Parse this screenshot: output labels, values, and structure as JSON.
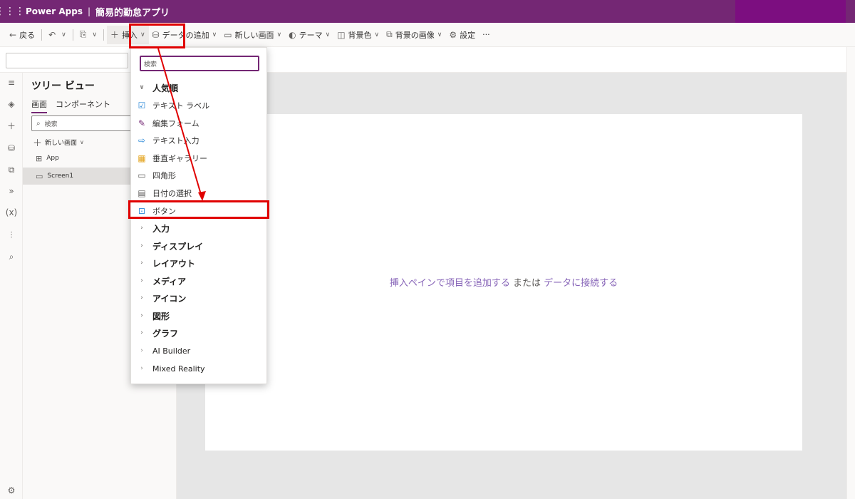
{
  "titlebar": {
    "product": "Power Apps",
    "separator": "|",
    "document": "簡易的勤怠アプリ"
  },
  "toolbar": {
    "back": "戻る",
    "insert": "挿入",
    "add_data": "データの追加",
    "new_screen": "新しい画面",
    "theme": "テーマ",
    "background_color": "背景色",
    "background_image": "背景の画像",
    "settings": "設定",
    "more": "···"
  },
  "tree": {
    "title": "ツリー ビュー",
    "tab_screens": "画面",
    "tab_components": "コンポーネント",
    "search_placeholder": "検索",
    "new_screen": "新しい画面",
    "items": [
      {
        "label": "App"
      },
      {
        "label": "Screen1"
      }
    ]
  },
  "canvas": {
    "hint_part1": "挿入ペインで項目を追加する",
    "hint_mid": "または",
    "hint_part2": "データに接続する"
  },
  "insert_menu": {
    "search_placeholder": "検索",
    "popular_group": "人気順",
    "popular_items": [
      {
        "label": "テキスト ラベル",
        "icon": "text-label-icon"
      },
      {
        "label": "編集フォーム",
        "icon": "edit-form-icon"
      },
      {
        "label": "テキスト入力",
        "icon": "text-input-icon"
      },
      {
        "label": "垂直ギャラリー",
        "icon": "gallery-icon"
      },
      {
        "label": "四角形",
        "icon": "rectangle-icon"
      },
      {
        "label": "日付の選択",
        "icon": "calendar-icon"
      },
      {
        "label": "ボタン",
        "icon": "button-icon"
      }
    ],
    "groups": [
      "入力",
      "ディスプレイ",
      "レイアウト",
      "メディア",
      "アイコン",
      "図形",
      "グラフ",
      "AI Builder",
      "Mixed Reality"
    ]
  },
  "colors": {
    "brand": "#742774",
    "highlight_box": "#e00000",
    "hint_link": "#8764b8"
  }
}
